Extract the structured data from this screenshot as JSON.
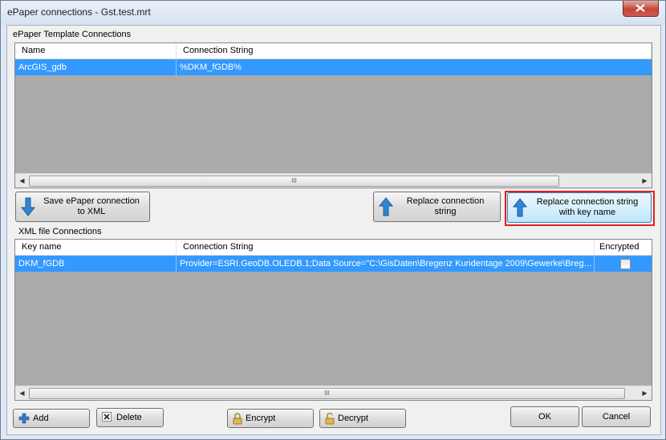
{
  "window": {
    "title": "ePaper connections - Gst.test.mrt"
  },
  "template_group": {
    "label": "ePaper Template Connections",
    "columns": [
      "Name",
      "Connection String"
    ],
    "rows": [
      {
        "name": "ArcGIS_gdb",
        "connection": "%DKM_fGDB%"
      }
    ]
  },
  "actions": {
    "save_xml": {
      "line1": "Save ePaper connection",
      "line2": "to XML"
    },
    "replace": {
      "line1": "Replace connection",
      "line2": "string"
    },
    "replace_key": {
      "line1": "Replace connection string",
      "line2": "with key name"
    }
  },
  "xml_group": {
    "label": "XML file Connections",
    "columns": [
      "Key name",
      "Connection String",
      "Encrypted"
    ],
    "rows": [
      {
        "key": "DKM_fGDB",
        "connection": "Provider=ESRI.GeoDB.OLEDB.1;Data Source=\"C:\\GisDaten\\Bregenz Kundentage 2009\\Gewerke\\Brege...",
        "encrypted": false
      }
    ]
  },
  "footer": {
    "add": "Add",
    "delete": "Delete",
    "encrypt": "Encrypt",
    "decrypt": "Decrypt",
    "ok": "OK",
    "cancel": "Cancel"
  },
  "scroll_grip": "III",
  "colors": {
    "selection": "#3399ff",
    "highlight_border": "#e02020",
    "grid_empty": "#ababab"
  }
}
